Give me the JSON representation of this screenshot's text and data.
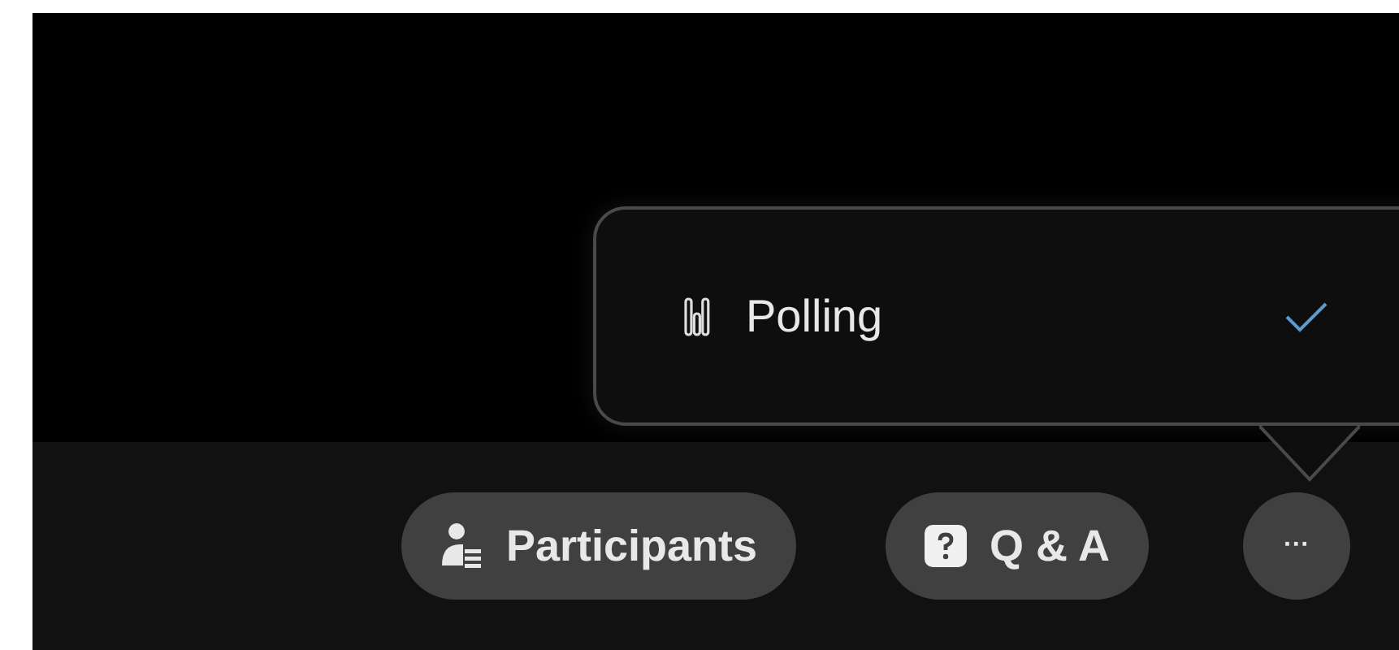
{
  "menu": {
    "items": [
      {
        "label": "Polling",
        "checked": true
      }
    ]
  },
  "toolbar": {
    "buttons": [
      {
        "kind": "participants",
        "label": "Participants"
      },
      {
        "kind": "qa",
        "label": "Q & A"
      },
      {
        "kind": "more",
        "label": "···"
      }
    ]
  }
}
